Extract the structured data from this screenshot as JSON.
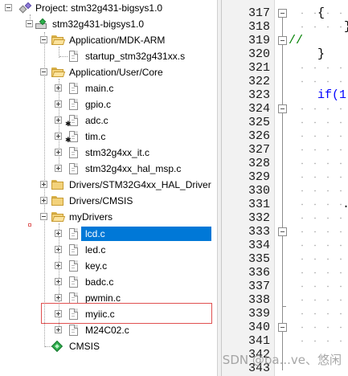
{
  "project_tree": {
    "project": "Project: stm32g431-bigsys1.0",
    "target": "stm32g431-bigsys1.0",
    "groups": [
      {
        "name": "Application/MDK-ARM",
        "files": [
          "startup_stm32g431xx.s"
        ]
      },
      {
        "name": "Application/User/Core",
        "files": [
          "main.c",
          "gpio.c",
          "adc.c",
          "tim.c",
          "stm32g4xx_it.c",
          "stm32g4xx_hal_msp.c"
        ]
      },
      {
        "name": "Drivers/STM32G4xx_HAL_Driver",
        "files": []
      },
      {
        "name": "Drivers/CMSIS",
        "files": []
      },
      {
        "name": "myDrivers",
        "files": [
          "lcd.c",
          "led.c",
          "key.c",
          "badc.c",
          "pwmin.c",
          "myiic.c",
          "M24C02.c"
        ]
      }
    ],
    "cmsis": "CMSIS",
    "selected_file": "lcd.c",
    "highlighted_file": "myiic.c"
  },
  "editor": {
    "line_numbers": [
      "317",
      "318",
      "319",
      "320",
      "321",
      "322",
      "323",
      "324",
      "325",
      "326",
      "327",
      "328",
      "329",
      "330",
      "331",
      "332",
      "333",
      "334",
      "335",
      "336",
      "337",
      "338",
      "339",
      "340",
      "341",
      "342",
      "343"
    ],
    "code_fragments": {
      "l317": "{",
      "l318": "}",
      "l319": "//",
      "l320": "}",
      "l323": "if(1",
      "l331": "."
    }
  },
  "watermark": "CSDN @ba...ve、悠闲"
}
